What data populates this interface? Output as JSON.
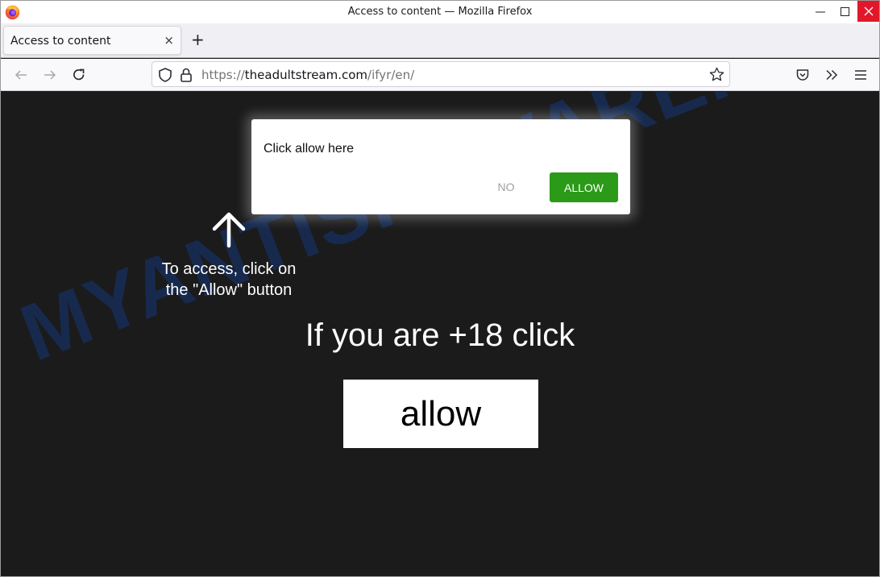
{
  "window": {
    "title": "Access to content — Mozilla Firefox",
    "minimize_icon": "minimize-icon",
    "maximize_icon": "maximize-icon",
    "close_icon": "close-icon"
  },
  "tabs": [
    {
      "label": "Access to content",
      "active": true,
      "close_symbol": "×"
    }
  ],
  "new_tab_symbol": "+",
  "navbar": {
    "back_icon": "arrow-left-icon",
    "forward_icon": "arrow-right-icon",
    "reload_icon": "reload-icon",
    "url": {
      "scheme": "https://",
      "host": "theadultstream.com",
      "path": "/ifyr/en/"
    },
    "right_icons": [
      "pocket-icon",
      "overflow-chevrons-icon",
      "hamburger-menu-icon"
    ]
  },
  "page": {
    "background_color": "#1b1b1b",
    "popup": {
      "title": "Click allow here",
      "no_label": "NO",
      "allow_label": "ALLOW",
      "allow_color": "#2b9a18"
    },
    "hint_text": "To access, click on the \"Allow\" button",
    "headline": "If you are +18 click",
    "big_button_label": "allow",
    "watermark": "MYANTISPYWARE.COM"
  }
}
